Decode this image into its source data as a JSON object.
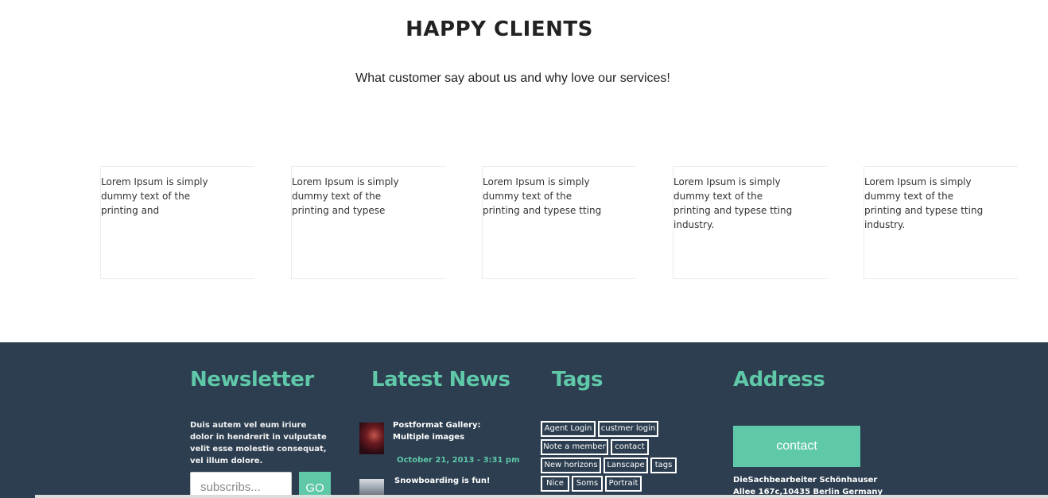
{
  "clients": {
    "title": "HAPPY CLIENTS",
    "subtitle": "What customer say about us and why love our services!",
    "testimonials": [
      "Lorem Ipsum is simply dummy text of the printing and",
      "Lorem Ipsum is simply dummy text of the printing and typese",
      "Lorem Ipsum is simply dummy text of the printing and typese tting",
      "Lorem Ipsum is simply dummy text of the printing and typese tting industry.",
      "Lorem Ipsum is simply dummy text of the printing and typese tting industry."
    ]
  },
  "footer": {
    "newsletter": {
      "heading": "Newsletter",
      "description": "Duis autem vel eum iriure dolor in hendrerit in vulputate velit esse molestie consequat, vel illum dolore.",
      "placeholder": "subscribs...",
      "button": "GO"
    },
    "news": {
      "heading": "Latest News",
      "posts": [
        {
          "title": "Postformat Gallery: Multiple images",
          "date": "October 21, 2013 - 3:31 pm"
        },
        {
          "title": "Snowboarding is fun!"
        }
      ]
    },
    "tags": {
      "heading": "Tags",
      "items": [
        "Agent Login",
        "custmer login",
        "Note a member",
        "contact",
        "New horizons",
        "Lanscape",
        "tags",
        "Nice",
        "Soms",
        "Portrait"
      ]
    },
    "address": {
      "heading": "Address",
      "button": "contact",
      "text": "DieSachbearbeiter Schönhauser Allee 167c,10435 Berlin Germany"
    }
  },
  "colors": {
    "accent": "#5fc8a8",
    "footer_bg": "#2c3e50"
  }
}
